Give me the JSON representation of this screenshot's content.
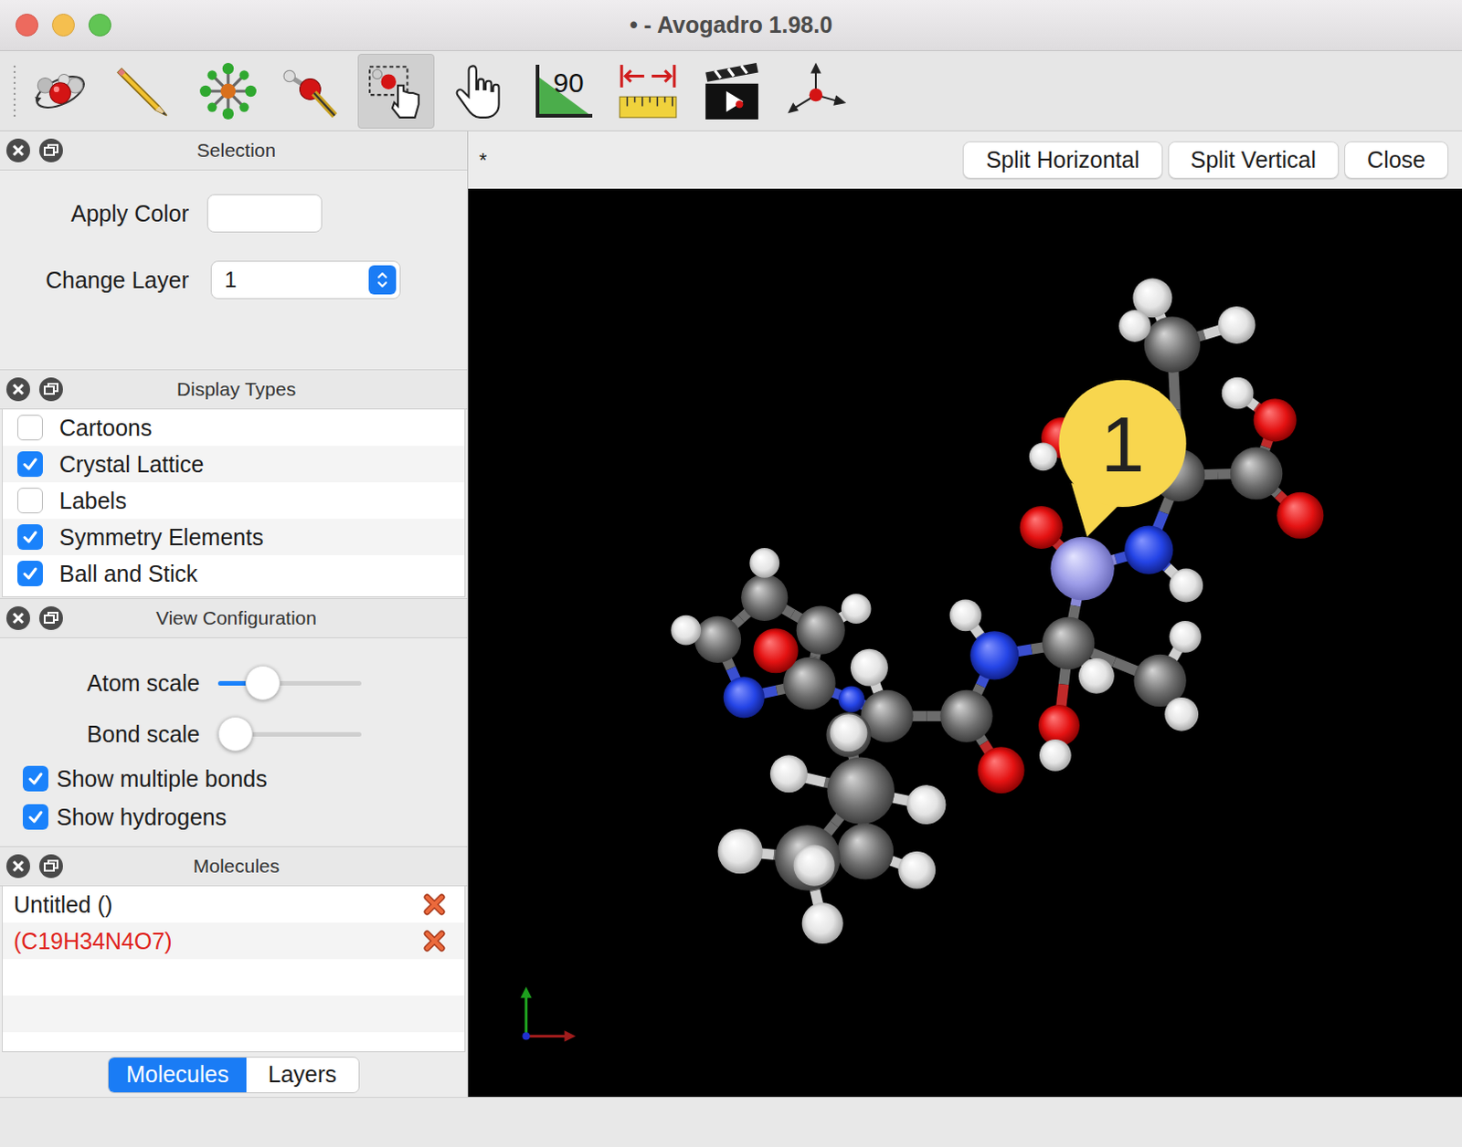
{
  "window": {
    "title": "• - Avogadro 1.98.0"
  },
  "toolbar": {
    "tools": [
      {
        "kind": "navigate",
        "selected": false
      },
      {
        "kind": "draw",
        "selected": false
      },
      {
        "kind": "template",
        "selected": false
      },
      {
        "kind": "bond",
        "selected": false
      },
      {
        "kind": "select",
        "selected": true
      },
      {
        "kind": "manipulate",
        "selected": false
      },
      {
        "kind": "measure",
        "selected": false,
        "label": "90"
      },
      {
        "kind": "align",
        "selected": false
      },
      {
        "kind": "animation",
        "selected": false
      },
      {
        "kind": "axis",
        "selected": false
      }
    ]
  },
  "view": {
    "tab": "*",
    "buttons": [
      "Split Horizontal",
      "Split Vertical",
      "Close"
    ],
    "badge": "1"
  },
  "selection": {
    "title": "Selection",
    "apply_color": {
      "label": "Apply Color",
      "color": "#ffffff"
    },
    "change_layer": {
      "label": "Change Layer",
      "value": "1"
    }
  },
  "display_types": {
    "title": "Display Types",
    "items": [
      {
        "label": "Cartoons",
        "checked": false
      },
      {
        "label": "Crystal Lattice",
        "checked": true
      },
      {
        "label": "Labels",
        "checked": false
      },
      {
        "label": "Symmetry Elements",
        "checked": true
      },
      {
        "label": "Ball and Stick",
        "checked": true
      }
    ]
  },
  "view_configuration": {
    "title": "View Configuration",
    "sliders": [
      {
        "label": "Atom scale",
        "level": 0.25
      },
      {
        "label": "Bond scale",
        "level": 0
      }
    ],
    "checkboxes": [
      {
        "label": "Show multiple bonds",
        "checked": true
      },
      {
        "label": "Show hydrogens",
        "checked": true
      }
    ]
  },
  "molecules": {
    "title": "Molecules",
    "items": [
      {
        "label": "Untitled ()",
        "active": false
      },
      {
        "label": "(C19H34N4O7)",
        "active": true
      }
    ],
    "tabs": [
      {
        "label": "Molecules",
        "selected": true
      },
      {
        "label": "Layers",
        "selected": false
      }
    ]
  }
}
